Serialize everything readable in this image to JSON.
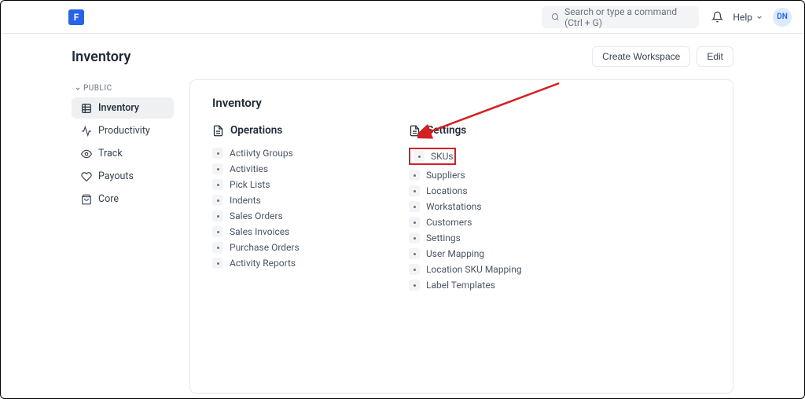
{
  "header": {
    "search_placeholder": "Search or type a command (Ctrl + G)",
    "help_label": "Help",
    "avatar_initials": "DN"
  },
  "page": {
    "title": "Inventory",
    "create_workspace_label": "Create Workspace",
    "edit_label": "Edit"
  },
  "sidebar": {
    "section_label": "PUBLIC",
    "items": [
      {
        "label": "Inventory"
      },
      {
        "label": "Productivity"
      },
      {
        "label": "Track"
      },
      {
        "label": "Payouts"
      },
      {
        "label": "Core"
      }
    ]
  },
  "panel": {
    "title": "Inventory",
    "operations_label": "Operations",
    "settings_label": "Settings",
    "operations": [
      "Actiivty Groups",
      "Activities",
      "Pick Lists",
      "Indents",
      "Sales Orders",
      "Sales Invoices",
      "Purchase Orders",
      "Activity Reports"
    ],
    "settings": [
      "SKUs",
      "Suppliers",
      "Locations",
      "Workstations",
      "Customers",
      "Settings",
      "User Mapping",
      "Location SKU Mapping",
      "Label Templates"
    ]
  }
}
